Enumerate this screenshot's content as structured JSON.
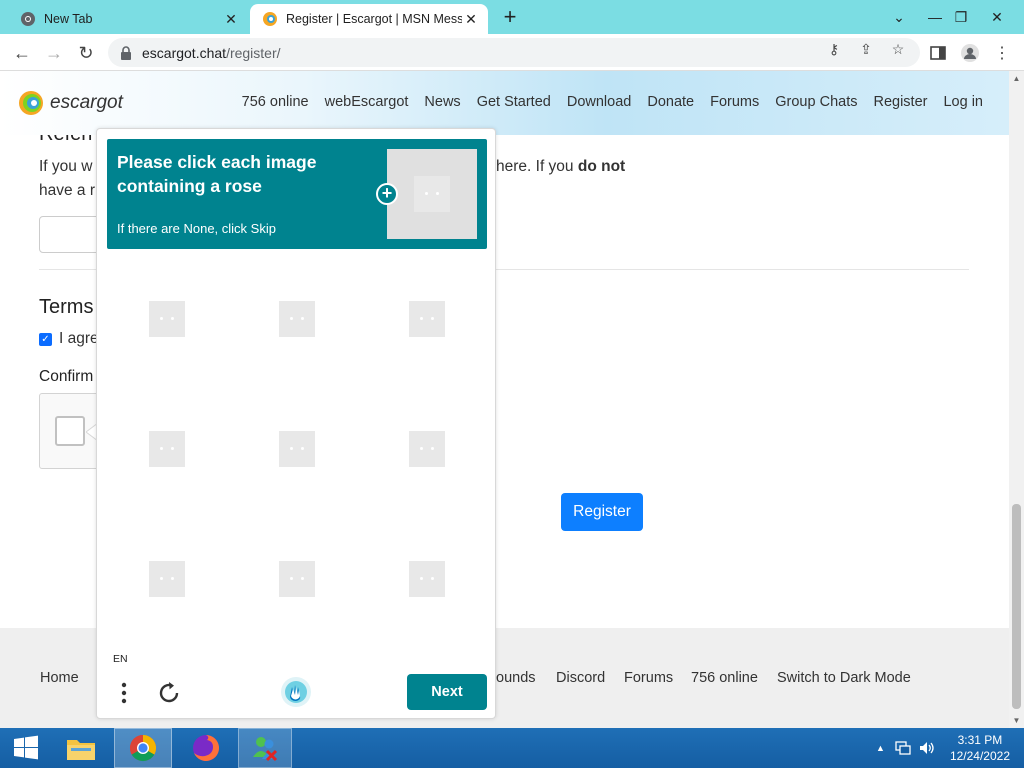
{
  "browser": {
    "tabs": [
      {
        "label": "New Tab"
      },
      {
        "label": "Register | Escargot | MSN Messe"
      }
    ],
    "url_host": "escargot.chat",
    "url_path": "/register/"
  },
  "site": {
    "brand": "escargot",
    "nav": [
      "756 online",
      "webEscargot",
      "News",
      "Get Started",
      "Download",
      "Donate",
      "Forums",
      "Group Chats",
      "Register",
      "Log in"
    ]
  },
  "form": {
    "referral_heading": "Referr",
    "referral_text_start": "If you w",
    "referral_text_line2": "have a r",
    "referral_text_right": "here. If you ",
    "referral_text_bold": "do not",
    "terms_heading": "Terms",
    "agree_label": "I agre",
    "confirm_label": "Confirm",
    "register_button": "Register"
  },
  "captcha": {
    "title": "Please click each image containing a rose",
    "subtitle": "If there are None, click Skip",
    "language": "EN",
    "next_button": "Next",
    "accent_color": "#00838f"
  },
  "footer": {
    "links": [
      "Home",
      "ounds",
      "Discord",
      "Forums",
      "756 online",
      "Switch to Dark Mode"
    ]
  },
  "taskbar": {
    "time": "3:31 PM",
    "date": "12/24/2022"
  }
}
